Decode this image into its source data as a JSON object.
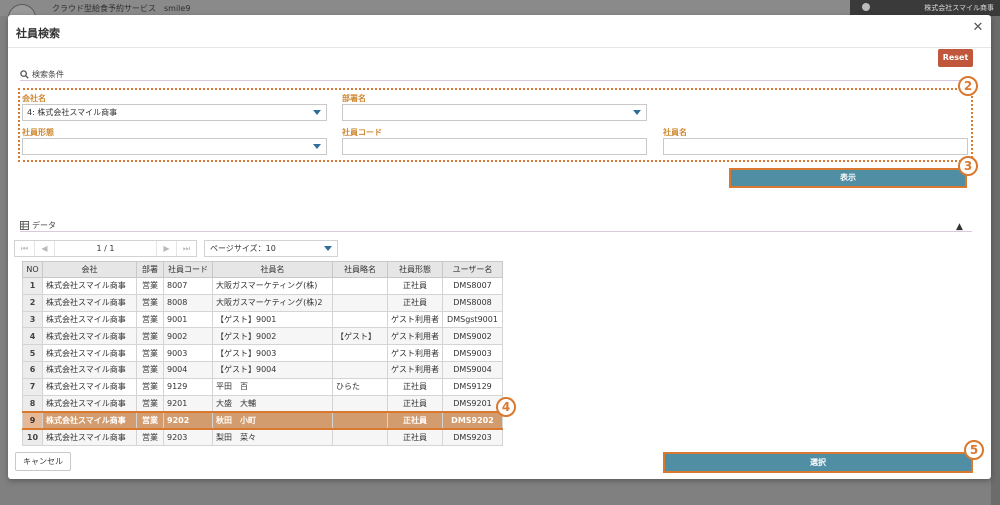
{
  "background": {
    "app_title": "クラウド型給食予約サービス　smile9",
    "company": "株式会社スマイル商事"
  },
  "modal": {
    "title": "社員検索",
    "reset_label": "Reset",
    "conditions": {
      "heading": "検索条件",
      "company_label": "会社名",
      "company_value": "4: 株式会社スマイル商事",
      "dept_label": "部署名",
      "dept_value": "",
      "type_label": "社員形態",
      "type_value": "",
      "code_label": "社員コード",
      "code_value": "",
      "name_label": "社員名",
      "name_value": ""
    },
    "show_label": "表示",
    "data_heading": "データ",
    "pager": {
      "first": "⏮",
      "prev": "◀",
      "info": "1 / 1",
      "next": "▶",
      "last": "⏭",
      "page_size": "ページサイズ：10"
    },
    "table": {
      "columns": [
        "NO",
        "会社",
        "部署",
        "社員コード",
        "社員名",
        "社員略名",
        "社員形態",
        "ユーザー名"
      ],
      "rows": [
        [
          "1",
          "株式会社スマイル商事",
          "営業",
          "8007",
          "大阪ガスマーケティング(株)",
          "",
          "正社員",
          "DMS8007"
        ],
        [
          "2",
          "株式会社スマイル商事",
          "営業",
          "8008",
          "大阪ガスマーケティング(株)2",
          "",
          "正社員",
          "DMS8008"
        ],
        [
          "3",
          "株式会社スマイル商事",
          "営業",
          "9001",
          "【ゲスト】9001",
          "",
          "ゲスト利用者",
          "DMSgst9001"
        ],
        [
          "4",
          "株式会社スマイル商事",
          "営業",
          "9002",
          "【ゲスト】9002",
          "【ゲスト】",
          "ゲスト利用者",
          "DMS9002"
        ],
        [
          "5",
          "株式会社スマイル商事",
          "営業",
          "9003",
          "【ゲスト】9003",
          "",
          "ゲスト利用者",
          "DMS9003"
        ],
        [
          "6",
          "株式会社スマイル商事",
          "営業",
          "9004",
          "【ゲスト】9004",
          "",
          "ゲスト利用者",
          "DMS9004"
        ],
        [
          "7",
          "株式会社スマイル商事",
          "営業",
          "9129",
          "平田　百",
          "ひらた",
          "正社員",
          "DMS9129"
        ],
        [
          "8",
          "株式会社スマイル商事",
          "営業",
          "9201",
          "大盛　大輔",
          "",
          "正社員",
          "DMS9201"
        ],
        [
          "9",
          "株式会社スマイル商事",
          "営業",
          "9202",
          "秋田　小町",
          "",
          "正社員",
          "DMS9202"
        ],
        [
          "10",
          "株式会社スマイル商事",
          "営業",
          "9203",
          "梨田　菜々",
          "",
          "正社員",
          "DMS9203"
        ]
      ],
      "selected_row": 8
    },
    "cancel_label": "キャンセル",
    "select_label": "選択"
  },
  "annotations": [
    "2",
    "3",
    "4",
    "5"
  ],
  "colors": {
    "accent_button": "#4f8ea3",
    "reset_button": "#c0563b",
    "highlight_border": "#d9782f",
    "selected_row": "#d39c6e",
    "label": "#d08a35"
  }
}
